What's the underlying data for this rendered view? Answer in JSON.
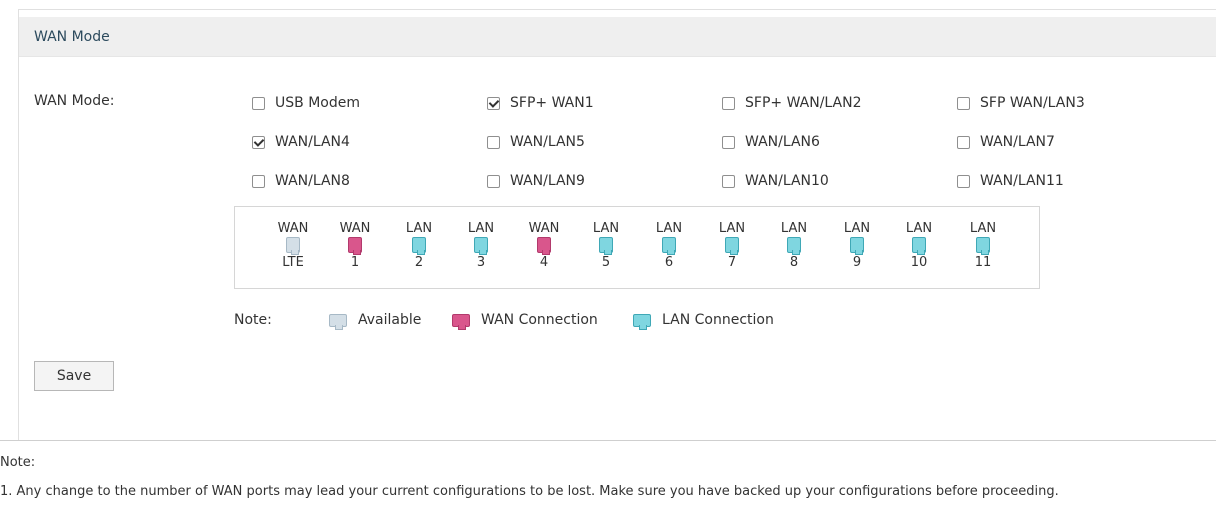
{
  "panel": {
    "title": "WAN Mode"
  },
  "form": {
    "label": "WAN Mode:",
    "options": [
      {
        "label": "USB Modem",
        "checked": false
      },
      {
        "label": "SFP+ WAN1",
        "checked": true
      },
      {
        "label": "SFP+ WAN/LAN2",
        "checked": false
      },
      {
        "label": "SFP WAN/LAN3",
        "checked": false
      },
      {
        "label": "WAN/LAN4",
        "checked": true
      },
      {
        "label": "WAN/LAN5",
        "checked": false
      },
      {
        "label": "WAN/LAN6",
        "checked": false
      },
      {
        "label": "WAN/LAN7",
        "checked": false
      },
      {
        "label": "WAN/LAN8",
        "checked": false
      },
      {
        "label": "WAN/LAN9",
        "checked": false
      },
      {
        "label": "WAN/LAN10",
        "checked": false
      },
      {
        "label": "WAN/LAN11",
        "checked": false
      }
    ]
  },
  "ports": [
    {
      "type": "WAN",
      "number": "LTE",
      "status": "available"
    },
    {
      "type": "WAN",
      "number": "1",
      "status": "wan"
    },
    {
      "type": "LAN",
      "number": "2",
      "status": "lan"
    },
    {
      "type": "LAN",
      "number": "3",
      "status": "lan"
    },
    {
      "type": "WAN",
      "number": "4",
      "status": "wan"
    },
    {
      "type": "LAN",
      "number": "5",
      "status": "lan"
    },
    {
      "type": "LAN",
      "number": "6",
      "status": "lan"
    },
    {
      "type": "LAN",
      "number": "7",
      "status": "lan"
    },
    {
      "type": "LAN",
      "number": "8",
      "status": "lan"
    },
    {
      "type": "LAN",
      "number": "9",
      "status": "lan"
    },
    {
      "type": "LAN",
      "number": "10",
      "status": "lan"
    },
    {
      "type": "LAN",
      "number": "11",
      "status": "lan"
    }
  ],
  "legend": {
    "note": "Note:",
    "available": "Available",
    "wan": "WAN Connection",
    "lan": "LAN Connection"
  },
  "colors": {
    "available": "#d4dfe7",
    "wan": "#d9568c",
    "lan": "#7fd6e0",
    "header_bg": "#efefef"
  },
  "buttons": {
    "save": "Save"
  },
  "footer": {
    "note_title": "Note:",
    "note_text": "1. Any change to the number of WAN ports may lead your current configurations to be lost. Make sure you have backed up your configurations before proceeding."
  }
}
